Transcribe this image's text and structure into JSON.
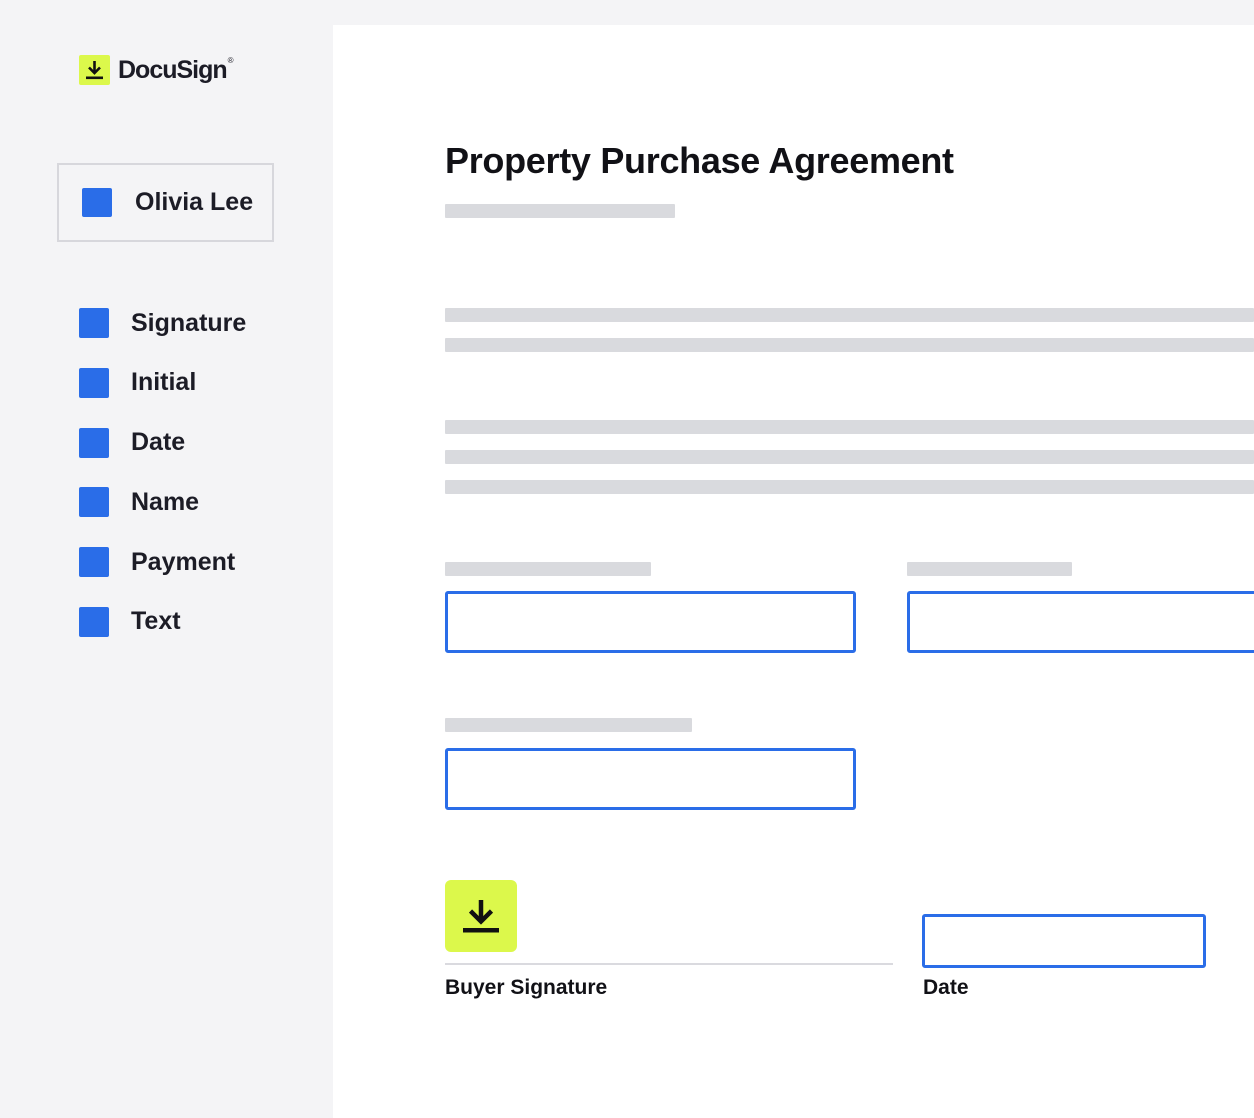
{
  "brand": {
    "name": "DocuSign",
    "trademark": "®",
    "accent_color": "#dcf84b",
    "logo_icon": "download-arrow-icon"
  },
  "recipient": {
    "name": "Olivia Lee",
    "color": "#2a6de8"
  },
  "field_palette": {
    "items": [
      {
        "label": "Signature"
      },
      {
        "label": "Initial"
      },
      {
        "label": "Date"
      },
      {
        "label": "Name"
      },
      {
        "label": "Payment"
      },
      {
        "label": "Text"
      }
    ],
    "item_color": "#2a6de8"
  },
  "document": {
    "title": "Property Purchase Agreement",
    "field_border_color": "#2a6de8",
    "signature_tag_icon": "download-arrow-icon",
    "signature_caption": "Buyer Signature",
    "date_caption": "Date"
  }
}
